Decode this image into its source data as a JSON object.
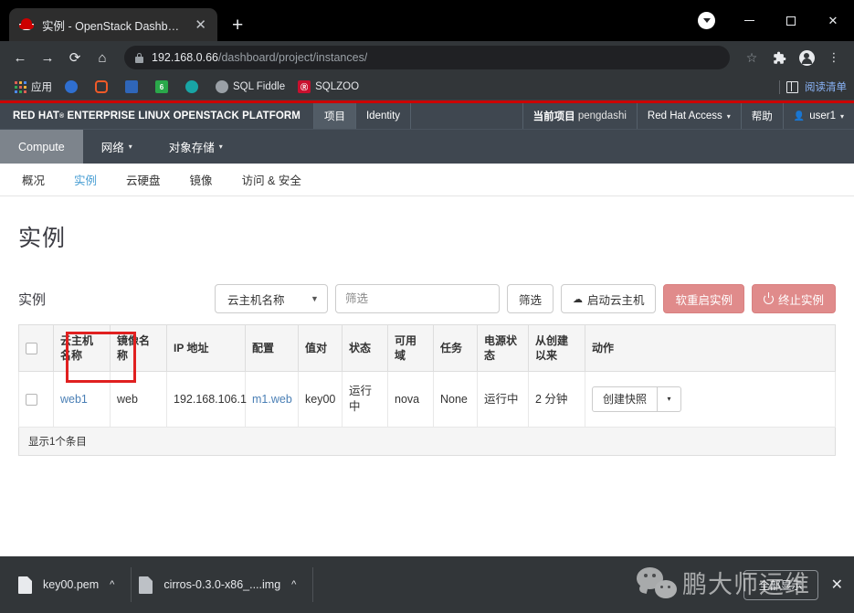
{
  "browser": {
    "tab": {
      "title": "实例 - OpenStack Dashboard",
      "close_label": "✕",
      "favicon": "redhat-fedora-icon"
    },
    "new_tab_label": "+",
    "window_controls": {
      "minimize": "—",
      "maximize": "□",
      "close": "✕"
    },
    "toolbar": {
      "back": "←",
      "forward": "→",
      "reload": "⟳",
      "home": "⌂",
      "url_host": "192.168.0.66",
      "url_path": "/dashboard/project/instances/",
      "star": "☆",
      "extensions": "puzzle-icon",
      "profile": "avatar-icon",
      "menu": "⋮"
    },
    "bookmarks": {
      "apps_label": "应用",
      "items": [
        {
          "label": "",
          "icon": "blue-circle-favicon",
          "color": "#2f6fd0"
        },
        {
          "label": "",
          "icon": "orange-bracket-favicon",
          "color": "#f05a28"
        },
        {
          "label": "",
          "icon": "blue-swoosh-favicon",
          "color": "#2f6fd0"
        },
        {
          "label": "",
          "icon": "p6-favicon",
          "color": "#2aa84a"
        },
        {
          "label": "",
          "icon": "teal-eye-favicon",
          "color": "#18a5a5"
        },
        {
          "label": "SQL Fiddle",
          "icon": "gray-burst-favicon",
          "color": "#9aa0a6"
        },
        {
          "label": "SQLZOO",
          "icon": "sqlzoo-favicon",
          "color": "#c8102e"
        }
      ],
      "reading_list": "阅读清单",
      "reading_list_icon": "reading-list-icon"
    }
  },
  "openstack": {
    "brand": "RED HAT",
    "brand_sup": "®",
    "brand_rest": "ENTERPRISE LINUX OPENSTACK PLATFORM",
    "top_nav": [
      {
        "label": "项目",
        "active": true
      },
      {
        "label": "Identity",
        "active": false
      }
    ],
    "current_project_label": "当前项目",
    "current_project_value": "pengdashi",
    "redhat_access": "Red Hat Access",
    "help": "帮助",
    "user": "user1",
    "sub_nav": [
      {
        "label": "Compute",
        "active": true,
        "caret": false
      },
      {
        "label": "网络",
        "active": false,
        "caret": true
      },
      {
        "label": "对象存储",
        "active": false,
        "caret": true
      }
    ],
    "tabs": [
      {
        "label": "概况",
        "active": false
      },
      {
        "label": "实例",
        "active": true
      },
      {
        "label": "云硬盘",
        "active": false
      },
      {
        "label": "镜像",
        "active": false
      },
      {
        "label": "访问 & 安全",
        "active": false
      }
    ],
    "page_title": "实例",
    "table_caption": "实例",
    "filter": {
      "select_value": "云主机名称",
      "input_placeholder": "筛选",
      "input_value": "",
      "filter_button": "筛选"
    },
    "actions": {
      "launch": "启动云主机",
      "launch_icon": "upload-cloud-icon",
      "soft_reboot": "软重启实例",
      "terminate": "终止实例",
      "terminate_icon": "power-icon"
    },
    "table": {
      "columns": [
        "",
        "云主机名称",
        "镜像名称",
        "IP 地址",
        "配置",
        "值对",
        "状态",
        "可用域",
        "任务",
        "电源状态",
        "从创建以来",
        "动作"
      ],
      "rows": [
        {
          "name": "web1",
          "image": "web",
          "ip": "192.168.106.1",
          "flavor": "m1.web",
          "keypair": "key00",
          "status": "运行中",
          "zone": "nova",
          "task": "None",
          "power": "运行中",
          "uptime": "2 分钟",
          "action_label": "创建快照",
          "action_caret": "▾"
        }
      ],
      "footer": "显示1个条目"
    },
    "highlight_color": "#e02020"
  },
  "downloads": {
    "items": [
      {
        "name": "key00.pem",
        "icon": "file-icon",
        "caret": "^"
      },
      {
        "name": "cirros-0.3.0-x86_....img",
        "icon": "file-image-icon",
        "caret": "^"
      }
    ],
    "show_all": "全部显示",
    "close": "✕"
  },
  "watermark": {
    "text": "鹏大师运维",
    "logo": "wechat-logo"
  }
}
